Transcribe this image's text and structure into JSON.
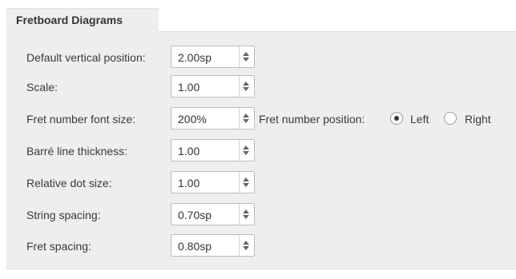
{
  "group": {
    "title": "Fretboard Diagrams"
  },
  "fields": [
    {
      "label": "Default vertical position:",
      "value": "2.00sp"
    },
    {
      "label": "Scale:",
      "value": "1.00"
    },
    {
      "label": "Fret number font size:",
      "value": "200%"
    },
    {
      "label": "Barré line thickness:",
      "value": "1.00"
    },
    {
      "label": "Relative dot size:",
      "value": "1.00"
    },
    {
      "label": "String spacing:",
      "value": "0.70sp"
    },
    {
      "label": "Fret spacing:",
      "value": "0.80sp"
    }
  ],
  "fret_number_position": {
    "label": "Fret number position:",
    "options": [
      {
        "label": "Left",
        "selected": true
      },
      {
        "label": "Right",
        "selected": false
      }
    ]
  },
  "icons": {
    "spin_arrows": "spinbox-up-down-arrows-icon",
    "radio": "radio-button-icon"
  },
  "colors": {
    "panel_background": "#eeeeee",
    "field_border": "#bcbcbc",
    "text": "#3a3a3a"
  }
}
